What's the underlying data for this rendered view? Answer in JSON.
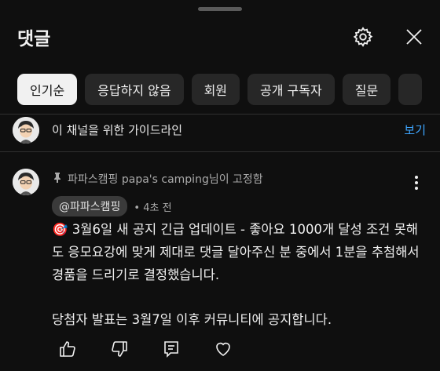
{
  "header": {
    "title": "댓글",
    "settings_icon": "gear-icon",
    "close_icon": "close-icon"
  },
  "chips": [
    {
      "label": "인기순",
      "active": true
    },
    {
      "label": "응답하지 않음",
      "active": false
    },
    {
      "label": "회원",
      "active": false
    },
    {
      "label": "공개 구독자",
      "active": false
    },
    {
      "label": "질문",
      "active": false
    }
  ],
  "guidelines": {
    "text": "이 채널을 위한 가이드라인",
    "link": "보기"
  },
  "comment": {
    "pinned_by": "파파스캠핑 papa's camping님이 고정함",
    "author": "@파파스캠핑",
    "time": "• 4초 전",
    "lines": [
      "🎯 3월6일 새 공지 긴급 업데이트 - 좋아요 1000개 달성 조건 못해도 응모요강에 맞게 제대로 댓글 달아주신 분 중에서 1분을 추첨해서 경품을 드리기로 결정했습니다.",
      "당첨자 발표는 3월7일 이후 커뮤니티에 공지합니다."
    ]
  },
  "colors": {
    "background": "#0f0f0f",
    "chip": "#272727",
    "link": "#3ea6ff"
  }
}
